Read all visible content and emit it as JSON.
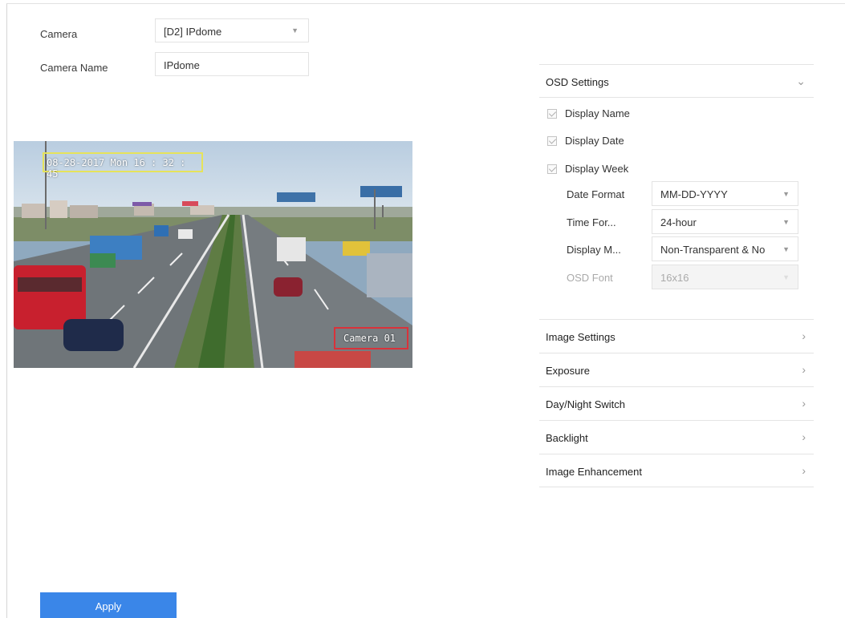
{
  "camera": {
    "label": "Camera",
    "value": "[D2] IPdome"
  },
  "camera_name": {
    "label": "Camera Name",
    "value": "IPdome"
  },
  "preview": {
    "osd_date_text": "08-28-2017  Mon 16 : 32 : 45",
    "osd_name_text": "Camera 01"
  },
  "osd_settings": {
    "title": "OSD Settings",
    "display_name": "Display Name",
    "display_date": "Display Date",
    "display_week": "Display Week",
    "date_format": {
      "label": "Date Format",
      "value": "MM-DD-YYYY"
    },
    "time_format": {
      "label": "Time For...",
      "value": "24-hour"
    },
    "display_mode": {
      "label": "Display M...",
      "value": "Non-Transparent & No"
    },
    "osd_font": {
      "label": "OSD Font",
      "value": "16x16"
    }
  },
  "sections": [
    {
      "label": "Image Settings"
    },
    {
      "label": "Exposure"
    },
    {
      "label": "Day/Night Switch"
    },
    {
      "label": "Backlight"
    },
    {
      "label": "Image Enhancement"
    }
  ],
  "apply_label": "Apply"
}
